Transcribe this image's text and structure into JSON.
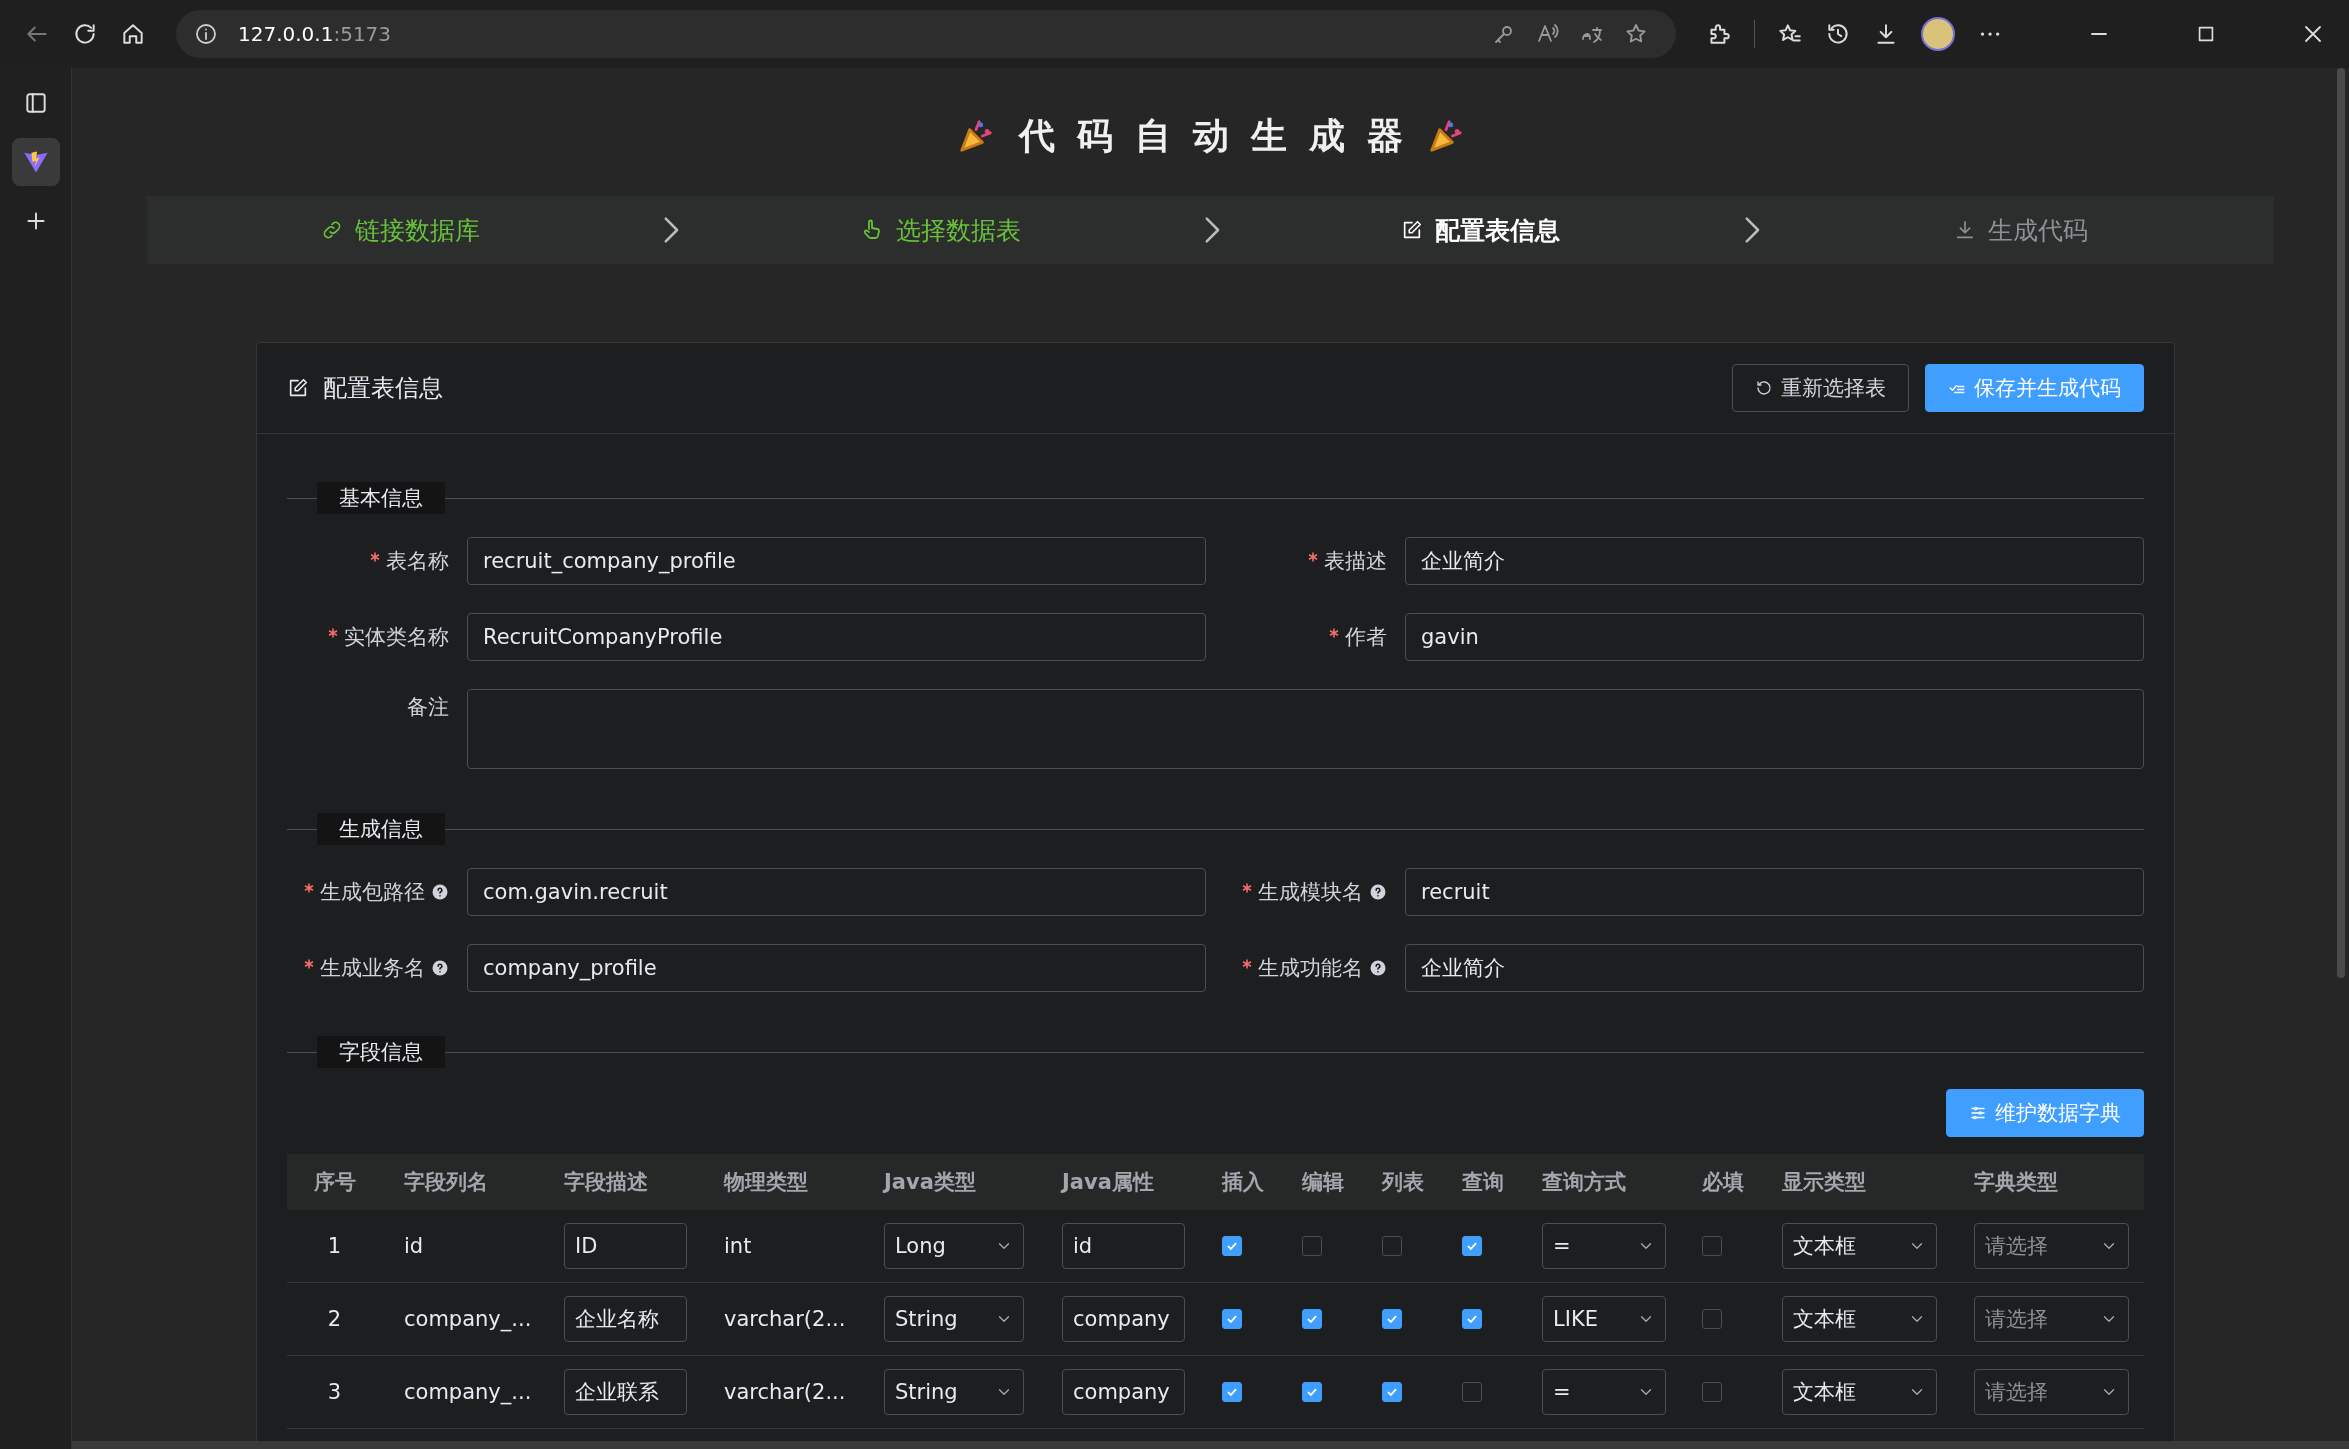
{
  "browser": {
    "url_host": "127.0.0.1",
    "url_port": ":5173"
  },
  "header": {
    "title": "代码自动生成器"
  },
  "steps": [
    {
      "label": "链接数据库",
      "completed": true,
      "selected": false
    },
    {
      "label": "选择数据表",
      "completed": true,
      "selected": false
    },
    {
      "label": "配置表信息",
      "selected": true
    },
    {
      "label": "生成代码",
      "completed": false,
      "selected": false
    }
  ],
  "card": {
    "title": "配置表信息",
    "buttons": [
      {
        "label": "重新选择表",
        "kind": "default"
      },
      {
        "label": "保存并生成代码",
        "kind": "primary"
      }
    ]
  },
  "sections": [
    {
      "title": "基本信息",
      "fields": [
        {
          "label": "表名称",
          "required": true,
          "kind": "input",
          "value": "recruit_company_profile"
        },
        {
          "label": "表描述",
          "required": true,
          "kind": "input",
          "value": "企业简介"
        },
        {
          "label": "实体类名称",
          "required": true,
          "kind": "input",
          "value": "RecruitCompanyProfile"
        },
        {
          "label": "作者",
          "required": true,
          "kind": "input",
          "value": "gavin"
        },
        {
          "label": "备注",
          "kind": "textarea"
        }
      ]
    },
    {
      "title": "生成信息",
      "fields": [
        {
          "label": "生成包路径",
          "required": true,
          "help": true,
          "kind": "input",
          "value": "com.gavin.recruit"
        },
        {
          "label": "生成模块名",
          "required": true,
          "help": true,
          "kind": "input",
          "value": "recruit"
        },
        {
          "label": "生成业务名",
          "required": true,
          "help": true,
          "kind": "input",
          "value": "company_profile"
        },
        {
          "label": "生成功能名",
          "required": true,
          "help": true,
          "kind": "input",
          "value": "企业简介"
        }
      ]
    }
  ],
  "fields_section": {
    "title": "字段信息",
    "button": "维护数据字典",
    "table": {
      "columns": [
        "序号",
        "字段列名",
        "字段描述",
        "物理类型",
        "Java类型",
        "Java属性",
        "插入",
        "编辑",
        "列表",
        "查询",
        "查询方式",
        "必填",
        "显示类型",
        "字典类型"
      ],
      "rows": [
        {
          "index": "1",
          "column_name": "id",
          "description": "ID",
          "physical_type": "int",
          "java_type": "Long",
          "java_field": "id",
          "insert": true,
          "edit": false,
          "list": false,
          "query": true,
          "query_type": "=",
          "required": false,
          "display_type": "文本框",
          "dict_placeholder": "请选择"
        },
        {
          "index": "2",
          "column_name": "company_...",
          "description": "企业名称",
          "physical_type": "varchar(2...",
          "java_type": "String",
          "java_field": "company",
          "insert": true,
          "edit": true,
          "list": true,
          "query": true,
          "query_type": "LIKE",
          "required": false,
          "display_type": "文本框",
          "dict_placeholder": "请选择"
        },
        {
          "index": "3",
          "column_name": "company_...",
          "description": "企业联系",
          "physical_type": "varchar(2...",
          "java_type": "String",
          "java_field": "company",
          "insert": true,
          "edit": true,
          "list": true,
          "query": false,
          "query_type": "=",
          "required": false,
          "display_type": "文本框",
          "dict_placeholder": "请选择"
        }
      ]
    }
  }
}
